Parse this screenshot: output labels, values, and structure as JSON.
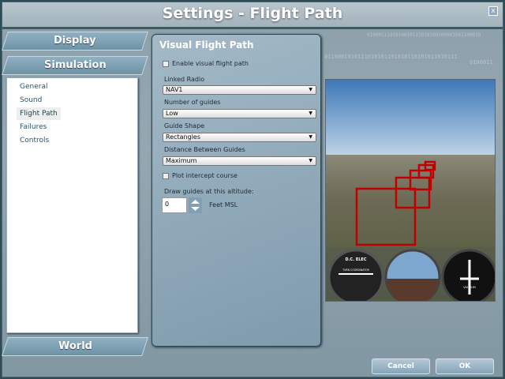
{
  "window": {
    "title": "Settings - Flight Path",
    "close_label": "x"
  },
  "background_binary": [
    "0100011101010010111010100100001001100010",
    "0110001010111010101101010110101011010111",
    "0100011"
  ],
  "nav": {
    "tabs": [
      {
        "label": "Display"
      },
      {
        "label": "Simulation"
      },
      {
        "label": "World"
      }
    ],
    "items": [
      {
        "label": "General"
      },
      {
        "label": "Sound"
      },
      {
        "label": "Flight Path",
        "selected": true
      },
      {
        "label": "Failures"
      },
      {
        "label": "Controls"
      }
    ]
  },
  "panel": {
    "title": "Visual Flight Path",
    "enable_label": "Enable visual flight path",
    "enable_checked": false,
    "linked_radio_label": "Linked Radio",
    "linked_radio_value": "NAV1",
    "guides_label": "Number of guides",
    "guides_value": "Low",
    "shape_label": "Guide Shape",
    "shape_value": "Rectangles",
    "distance_label": "Distance Between Guides",
    "distance_value": "Maximum",
    "intercept_label": "Plot intercept course",
    "intercept_checked": false,
    "altitude_label": "Draw guides at this altitude:",
    "altitude_value": "0",
    "altitude_unit": "Feet MSL"
  },
  "preview": {
    "gauge_labels": [
      "D.C. ELEC",
      "TURN COORDINATOR",
      "VACUUM"
    ]
  },
  "buttons": {
    "cancel": "Cancel",
    "ok": "OK"
  },
  "colors": {
    "guide": "#c00000",
    "accent": "#7f9bad"
  }
}
